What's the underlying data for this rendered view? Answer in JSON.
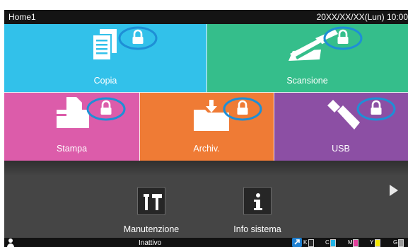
{
  "header": {
    "title": "Home1",
    "datetime": "20XX/XX/XX(Lun) 10:00"
  },
  "tiles": {
    "copy": {
      "label": "Copia",
      "color": "#32c1ea",
      "icon": "document-stack-icon",
      "locked": true
    },
    "scan": {
      "label": "Scansione",
      "color": "#35be8b",
      "icon": "scanner-icon",
      "locked": true
    },
    "print": {
      "label": "Stampa",
      "color": "#dc5caa",
      "icon": "printer-icon",
      "locked": true
    },
    "archive": {
      "label": "Archiv.",
      "color": "#ef7b35",
      "icon": "folder-download-icon",
      "locked": true
    },
    "usb": {
      "label": "USB",
      "color": "#8c4fa4",
      "icon": "usb-stick-icon",
      "locked": true
    }
  },
  "lock_highlight_color": "#1e8fd6",
  "lower": {
    "maintenance": {
      "label": "Manutenzione",
      "icon": "tools-icon"
    },
    "system_info": {
      "label": "Info sistema",
      "icon": "info-icon"
    },
    "next_icon": "triangle-right-icon"
  },
  "status": {
    "text": "Inattivo",
    "user_icon": "user-icon",
    "link_icon": "link-icon",
    "inks": [
      {
        "letter": "K",
        "color": "#ffffff"
      },
      {
        "letter": "C",
        "color": "#21b5e8"
      },
      {
        "letter": "M",
        "color": "#e33d9b"
      },
      {
        "letter": "Y",
        "color": "#f2e600"
      },
      {
        "letter": "G",
        "color": "#9a9a9a"
      }
    ]
  }
}
